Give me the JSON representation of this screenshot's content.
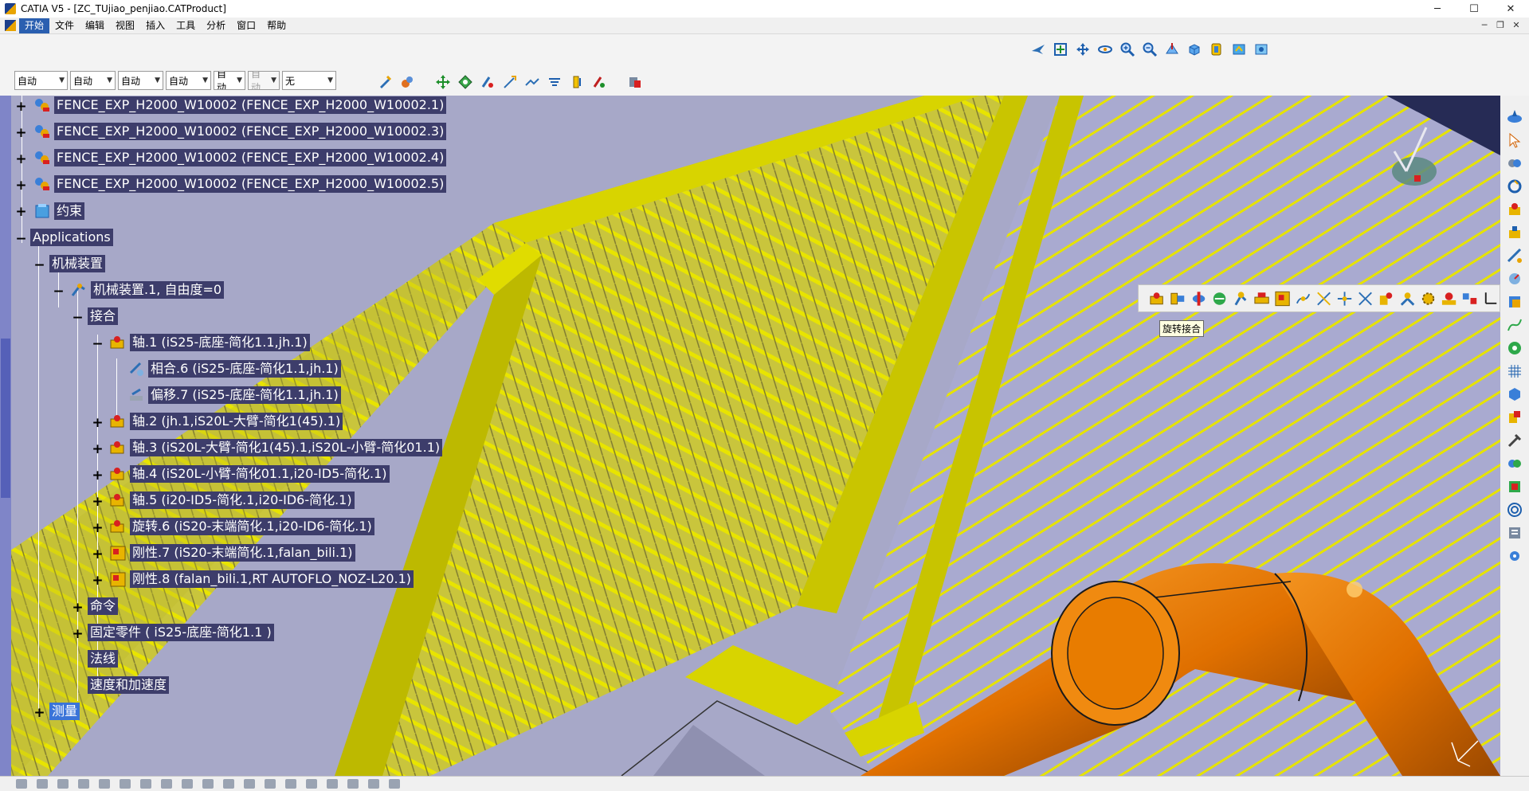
{
  "window": {
    "title": "CATIA V5 - [ZC_TUjiao_penjiao.CATProduct]",
    "minimize": "─",
    "maximize": "☐",
    "close": "✕"
  },
  "menu": {
    "items": [
      "开始",
      "文件",
      "编辑",
      "视图",
      "插入",
      "工具",
      "分析",
      "窗口",
      "帮助"
    ],
    "active_index": 0,
    "doc_min": "─",
    "doc_restore": "❐",
    "doc_close": "✕"
  },
  "dropdowns": [
    {
      "value": "自动",
      "disabled": false
    },
    {
      "value": "自动",
      "disabled": false
    },
    {
      "value": "自动",
      "disabled": false
    },
    {
      "value": "自动",
      "disabled": false
    },
    {
      "value": "自动",
      "disabled": false
    },
    {
      "value": "自动",
      "disabled": true
    },
    {
      "value": "无",
      "disabled": false
    }
  ],
  "tree": {
    "fences": [
      "FENCE_EXP_H2000_W10002 (FENCE_EXP_H2000_W10002.1)",
      "FENCE_EXP_H2000_W10002 (FENCE_EXP_H2000_W10002.3)",
      "FENCE_EXP_H2000_W10002 (FENCE_EXP_H2000_W10002.4)",
      "FENCE_EXP_H2000_W10002 (FENCE_EXP_H2000_W10002.5)"
    ],
    "constraints": "约束",
    "applications": "Applications",
    "mechanisms": "机械装置",
    "mechanism1": "机械装置.1, 自由度=0",
    "joints": "接合",
    "joint_list": [
      "轴.1 (iS25-底座-简化1.1,jh.1)",
      "相合.6 (iS25-底座-简化1.1,jh.1)",
      "偏移.7 (iS25-底座-简化1.1,jh.1)",
      "轴.2 (jh.1,iS20L-大臂-简化1(45).1)",
      "轴.3 (iS20L-大臂-简化1(45).1,iS20L-小臂-简化01.1)",
      "轴.4 (iS20L-小臂-简化01.1,i20-ID5-简化.1)",
      "轴.5 (i20-ID5-简化.1,i20-ID6-简化.1)",
      "旋转.6 (iS20-末端简化.1,i20-ID6-简化.1)",
      "刚性.7 (iS20-末端简化.1,falan_bili.1)",
      "刚性.8 (falan_bili.1,RT AUTOFLO_NOZ-L20.1)"
    ],
    "commands": "命令",
    "fixed_part": "固定零件 ( iS25-底座-简化1.1 )",
    "laws": "法线",
    "speed_accel": "速度和加速度",
    "measure": "测量"
  },
  "tooltip": "旋转接合",
  "colors": {
    "viewport_bg": "#a7a8c8",
    "fence_yellow": "#d8d400",
    "robot_orange": "#e87800",
    "tree_label_bg": "#3d3d6b",
    "selection": "#3a74d8"
  },
  "icons": {
    "top": [
      "fly-mode-icon",
      "fit-all-icon",
      "pan-icon",
      "rotate-icon",
      "zoom-in-icon",
      "zoom-out-icon",
      "normal-view-icon",
      "iso-view-icon",
      "shading-icon",
      "hide-show-icon",
      "swap-space-icon"
    ],
    "graphic": [
      "move-icon",
      "snap-icon",
      "manipulate-icon",
      "explode-icon",
      "clash-icon",
      "section-icon",
      "distance-icon",
      "catalog-icon"
    ]
  }
}
